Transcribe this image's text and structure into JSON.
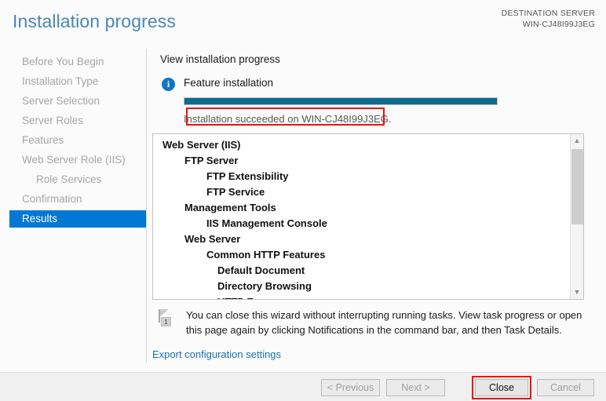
{
  "header": {
    "title": "Installation progress",
    "destination_label": "DESTINATION SERVER",
    "destination_server": "WIN-CJ48I99J3EG"
  },
  "sidebar": {
    "items": [
      {
        "label": "Before You Begin",
        "indent": false,
        "selected": false
      },
      {
        "label": "Installation Type",
        "indent": false,
        "selected": false
      },
      {
        "label": "Server Selection",
        "indent": false,
        "selected": false
      },
      {
        "label": "Server Roles",
        "indent": false,
        "selected": false
      },
      {
        "label": "Features",
        "indent": false,
        "selected": false
      },
      {
        "label": "Web Server Role (IIS)",
        "indent": false,
        "selected": false
      },
      {
        "label": "Role Services",
        "indent": true,
        "selected": false
      },
      {
        "label": "Confirmation",
        "indent": false,
        "selected": false
      },
      {
        "label": "Results",
        "indent": false,
        "selected": true
      }
    ]
  },
  "main": {
    "section_title": "View installation progress",
    "info_icon": "info-circle-icon",
    "info_glyph": "i",
    "installation_type_label": "Feature installation",
    "progress": {
      "percent": 100,
      "fill_color": "#0c6b8f"
    },
    "success_message": "Installation succeeded on WIN-CJ48I99J3EG.",
    "highlight_color": "#ee1111",
    "tree": [
      {
        "label": "Web Server (IIS)",
        "level": 0
      },
      {
        "label": "FTP Server",
        "level": 1
      },
      {
        "label": "FTP Extensibility",
        "level": 2
      },
      {
        "label": "FTP Service",
        "level": 2
      },
      {
        "label": "Management Tools",
        "level": 1
      },
      {
        "label": "IIS Management Console",
        "level": 2
      },
      {
        "label": "Web Server",
        "level": 1
      },
      {
        "label": "Common HTTP Features",
        "level": 2
      },
      {
        "label": "Default Document",
        "level": 3
      },
      {
        "label": "Directory Browsing",
        "level": 3
      },
      {
        "label": "HTTP Errors",
        "level": 3
      }
    ],
    "scrollbar": {
      "up_arrow": "chevron-up-icon",
      "down_arrow": "chevron-down-icon"
    },
    "notification": {
      "flag_icon": "flag-icon",
      "badge_count": "1",
      "text": "You can close this wizard without interrupting running tasks. View task progress or open this page again by clicking Notifications in the command bar, and then Task Details."
    },
    "export_link": "Export configuration settings"
  },
  "footer": {
    "buttons": [
      {
        "id": "previous",
        "label": "< Previous",
        "enabled": false,
        "highlighted": false
      },
      {
        "id": "next",
        "label": "Next >",
        "enabled": false,
        "highlighted": false
      },
      {
        "id": "close",
        "label": "Close",
        "enabled": true,
        "highlighted": true
      },
      {
        "id": "cancel",
        "label": "Cancel",
        "enabled": false,
        "highlighted": false
      }
    ]
  }
}
